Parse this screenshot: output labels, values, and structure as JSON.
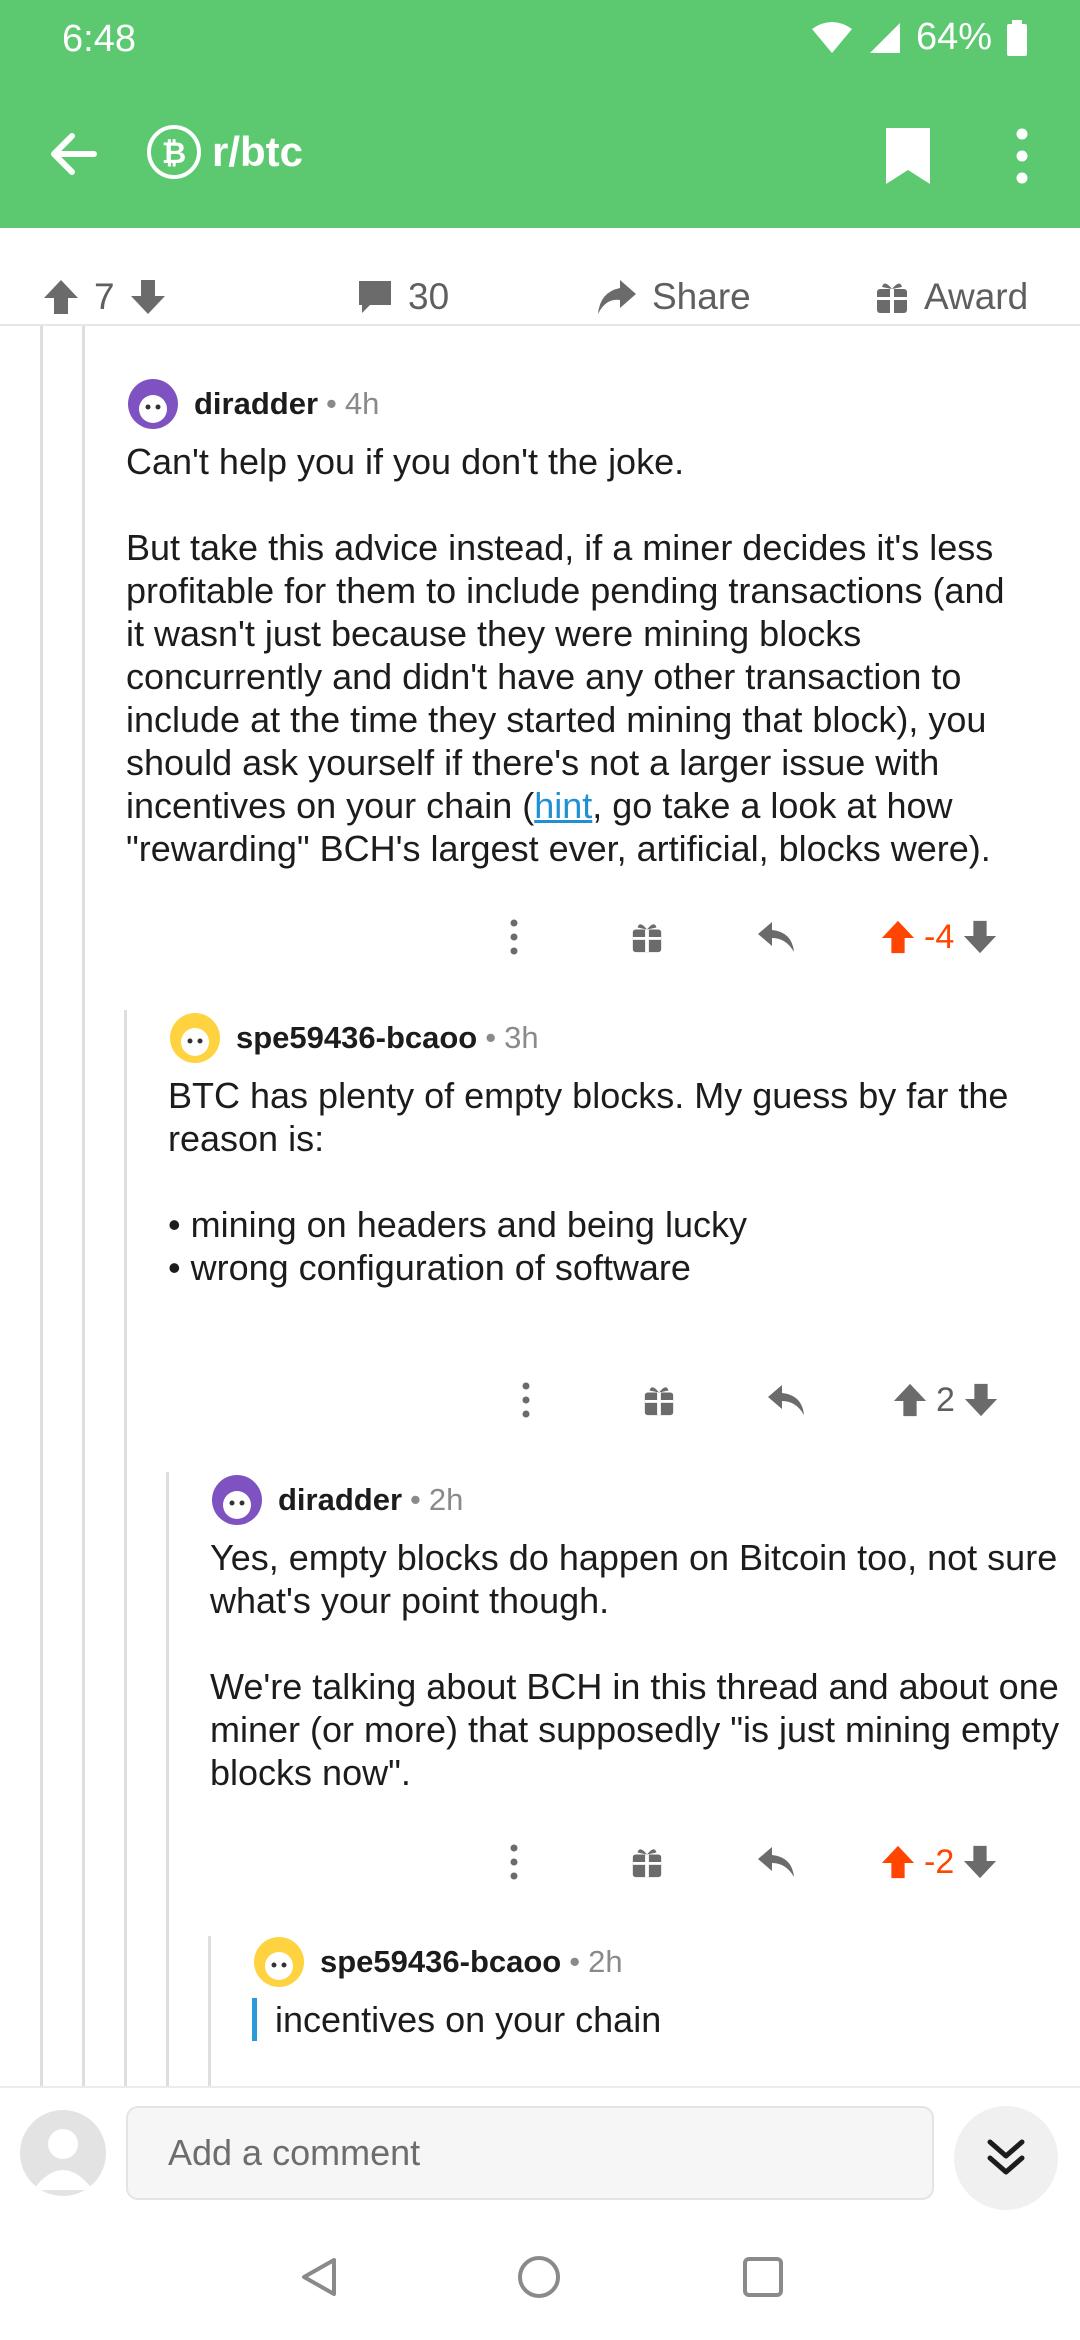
{
  "status": {
    "time": "6:48",
    "battery": "64%"
  },
  "app": {
    "subreddit": "r/btc"
  },
  "postbar": {
    "score": "7",
    "comments": "30",
    "share": "Share",
    "award": "Award"
  },
  "comments": [
    {
      "author": "diradder",
      "age": "4h",
      "paragraphs": [
        "Can't help you if you don't the joke."
      ],
      "p2_before_link": "But take this advice instead, if a miner decides it's less profitable for them to include pending transactions (and it wasn't just because they were mining blocks concurrently and didn't have any other transaction to include at the time they started mining that block), you should ask yourself if there's not a larger issue with incentives on your chain (",
      "p2_link": "hint",
      "p2_after_link": ", go take a look at how \"rewarding\" BCH's largest ever, artificial, blocks were).",
      "score": "-4"
    },
    {
      "author": "spe59436-bcaoo",
      "age": "3h",
      "p1": "BTC has plenty of empty blocks. My guess by far the reason is:",
      "bullets": [
        "mining on headers and being lucky",
        "wrong configuration of software"
      ],
      "score": "2"
    },
    {
      "author": "diradder",
      "age": "2h",
      "p1": "Yes, empty blocks do happen on Bitcoin too, not sure what's your point though.",
      "p2": "We're talking about BCH in this thread and about one miner (or more) that supposedly \"is just mining empty blocks now\".",
      "score": "-2"
    },
    {
      "author": "spe59436-bcaoo",
      "age": "2h",
      "quote": "incentives on your chain"
    }
  ],
  "bottom": {
    "placeholder": "Add a comment"
  },
  "colors": {
    "header": "#5cc971",
    "downvoted": "#ff4500",
    "link": "#1f8fd6",
    "quote_bar": "#2a9ad8"
  }
}
